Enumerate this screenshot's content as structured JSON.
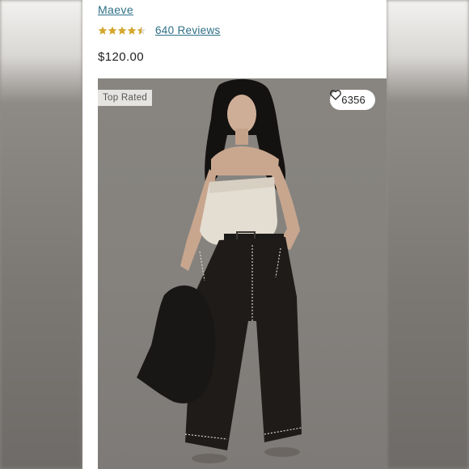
{
  "product": {
    "brand": "Maeve",
    "rating_stars": 4.5,
    "reviews_label": "640 Reviews",
    "price": "$120.00"
  },
  "image": {
    "badge": "Top Rated",
    "favorites_count": "6356"
  },
  "icons": {
    "star": "star-icon",
    "heart": "heart-outline-icon"
  },
  "colors": {
    "link": "#2d6f86",
    "star": "#d4a72c",
    "price": "#222222"
  }
}
